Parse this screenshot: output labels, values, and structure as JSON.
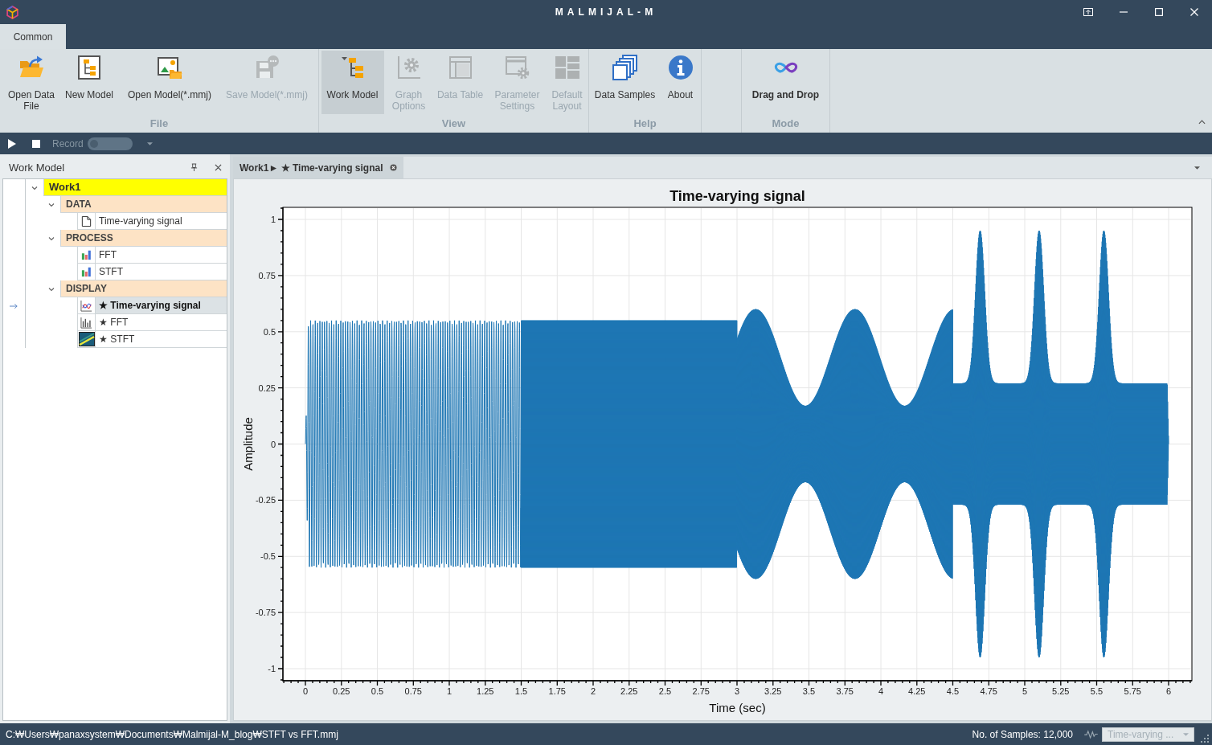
{
  "window": {
    "title": "MALMIJAL-M"
  },
  "ribbon_tabs": [
    {
      "label": "Common",
      "selected": true
    }
  ],
  "ribbon_groups": [
    {
      "label": "File",
      "buttons": [
        {
          "label": "Open Data File",
          "kind": "command",
          "disabled": false,
          "checked": false
        },
        {
          "label": "New Model",
          "kind": "command",
          "disabled": false,
          "checked": false
        },
        {
          "label": "Open Model(*.mmj)",
          "kind": "command",
          "disabled": false,
          "checked": false
        },
        {
          "label": "Save Model(*.mmj)",
          "kind": "command",
          "disabled": true,
          "checked": false
        }
      ]
    },
    {
      "label": "View",
      "buttons": [
        {
          "label": "Work Model",
          "kind": "command",
          "disabled": false,
          "checked": true
        },
        {
          "label": "Graph Options",
          "kind": "command",
          "disabled": true,
          "checked": false
        },
        {
          "label": "Data Table",
          "kind": "command",
          "disabled": true,
          "checked": false
        },
        {
          "label": "Parameter Settings",
          "kind": "command",
          "disabled": true,
          "checked": false
        },
        {
          "label": "Default Layout",
          "kind": "command",
          "disabled": true,
          "checked": false
        }
      ]
    },
    {
      "label": "Help",
      "buttons": [
        {
          "label": "Data Samples",
          "kind": "command",
          "disabled": false,
          "checked": false
        },
        {
          "label": "About",
          "kind": "command",
          "disabled": false,
          "checked": false
        }
      ]
    },
    {
      "label": "Mode",
      "buttons": [
        {
          "label": "Drag and Drop",
          "kind": "mode",
          "disabled": false,
          "checked": false
        }
      ]
    }
  ],
  "quick_toolbar": {
    "record_label": "Record",
    "record_on": false
  },
  "work_model_panel": {
    "title": "Work Model",
    "tree": [
      {
        "label": "Work1",
        "kind": "model",
        "expanded": true,
        "selected": false,
        "children": [
          {
            "label": "DATA",
            "kind": "category",
            "expanded": true,
            "selected": false,
            "children": [
              {
                "label": "Time-varying signal",
                "kind": "signal",
                "selected": false
              }
            ]
          },
          {
            "label": "PROCESS",
            "kind": "category",
            "expanded": true,
            "selected": false,
            "children": [
              {
                "label": "FFT",
                "kind": "transform",
                "selected": false
              },
              {
                "label": "STFT",
                "kind": "transform",
                "selected": false
              }
            ]
          },
          {
            "label": "DISPLAY",
            "kind": "category",
            "expanded": true,
            "selected": false,
            "children": [
              {
                "label": "★ Time-varying signal",
                "kind": "line-display",
                "selected": true
              },
              {
                "label": "★ FFT",
                "kind": "bar-display",
                "selected": false
              },
              {
                "label": "★ STFT",
                "kind": "map-display",
                "selected": false
              }
            ]
          }
        ]
      }
    ]
  },
  "document_tabs": [
    {
      "label": "Work1► ★ Time-varying signal",
      "selected": true
    }
  ],
  "plot": {
    "title": "Time-varying signal",
    "xlabel": "Time (sec)",
    "ylabel": "Amplitude",
    "xtick_labels": [
      "0",
      "0.25",
      "0.5",
      "0.75",
      "1",
      "1.25",
      "1.5",
      "1.75",
      "2",
      "2.25",
      "2.5",
      "2.75",
      "3",
      "3.25",
      "3.5",
      "3.75",
      "4",
      "4.25",
      "4.5",
      "4.75",
      "5",
      "5.25",
      "5.5",
      "5.75",
      "6"
    ],
    "ytick_labels": [
      "1",
      "0.75",
      "0.5",
      "0.25",
      "0",
      "-0.25",
      "-0.5",
      "-0.75",
      "-1"
    ]
  },
  "status_bar": {
    "path": "C:₩Users₩panaxsystem₩Documents₩Malmijal-M_blog₩STFT vs FFT.mmj",
    "samples": "No. of Samples: 12,000",
    "view_select": {
      "value": "Time-varying ...",
      "disabled": true
    }
  }
}
